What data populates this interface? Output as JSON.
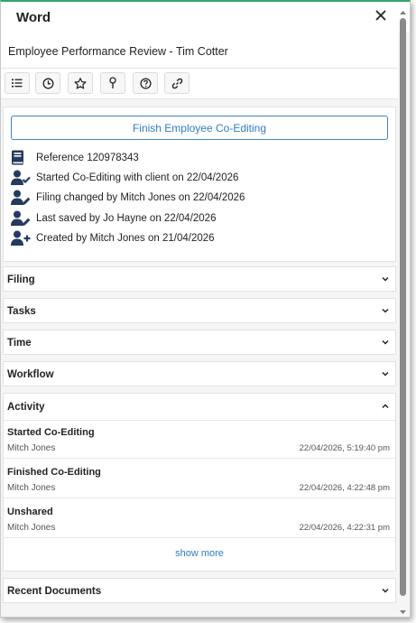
{
  "window": {
    "title": "Word"
  },
  "document": {
    "title": "Employee Performance Review - Tim Cotter"
  },
  "toolbar": {
    "buttons": [
      {
        "icon": "list-icon"
      },
      {
        "icon": "clock-icon"
      },
      {
        "icon": "star-icon"
      },
      {
        "icon": "pin-icon"
      },
      {
        "icon": "help-icon"
      },
      {
        "icon": "link-icon"
      }
    ]
  },
  "info": {
    "finish_button": "Finish Employee Co-Editing",
    "reference": "Reference 120978343",
    "started": "Started Co-Editing with client on 22/04/2026",
    "filing_changed": "Filing changed by Mitch Jones on 22/04/2026",
    "last_saved": "Last saved by Jo Hayne on 22/04/2026",
    "created": "Created by Mitch Jones on 21/04/2026"
  },
  "sections": {
    "filing": "Filing",
    "tasks": "Tasks",
    "time": "Time",
    "workflow": "Workflow",
    "recent_documents": "Recent Documents"
  },
  "activity": {
    "label": "Activity",
    "items": [
      {
        "title": "Started Co-Editing",
        "user": "Mitch Jones",
        "time": "22/04/2026, 5:19:40 pm"
      },
      {
        "title": "Finished Co-Editing",
        "user": "Mitch Jones",
        "time": "22/04/2026, 4:22:48 pm"
      },
      {
        "title": "Unshared",
        "user": "Mitch Jones",
        "time": "22/04/2026, 4:22:31 pm"
      }
    ],
    "show_more": "show more"
  },
  "colors": {
    "accent_blue": "#2f7dc2",
    "top_border_green": "#2ea76a",
    "icon_navy": "#243a5e"
  }
}
